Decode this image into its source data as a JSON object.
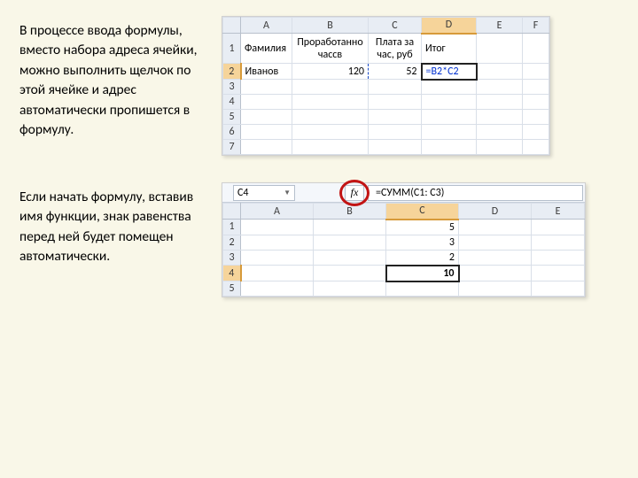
{
  "text1": "В процессе ввода формулы, вместо набора адреса ячейки, можно выполнить щелчок по этой ячейке и адрес автоматически пропишется в формулу.",
  "text2": "Если начать формулу, вставив имя функции, знак равенства перед ней будет помещен автоматически.",
  "sheet1": {
    "cols": [
      "A",
      "B",
      "C",
      "D",
      "E",
      "F"
    ],
    "rows": [
      "1",
      "2",
      "3",
      "4",
      "5",
      "6",
      "7"
    ],
    "headers": {
      "A1": "Фамилия",
      "B1": "Проработанно чассв",
      "C1": "Плата за час, руб",
      "D1": "Итог"
    },
    "data": {
      "A2": "Иванов",
      "B2": "120",
      "C2": "52",
      "D2": "=B2*C2"
    },
    "active_col": "D",
    "active_row": "2"
  },
  "sheet2": {
    "namebox": "C4",
    "fx_label": "fx",
    "formula": "=СУММ(C1: C3)",
    "cols": [
      "A",
      "B",
      "C",
      "D",
      "E"
    ],
    "rows": [
      "1",
      "2",
      "3",
      "4",
      "5"
    ],
    "data": {
      "C1": "5",
      "C2": "3",
      "C3": "2",
      "C4": "10"
    },
    "active_col": "C",
    "active_row": "4"
  }
}
